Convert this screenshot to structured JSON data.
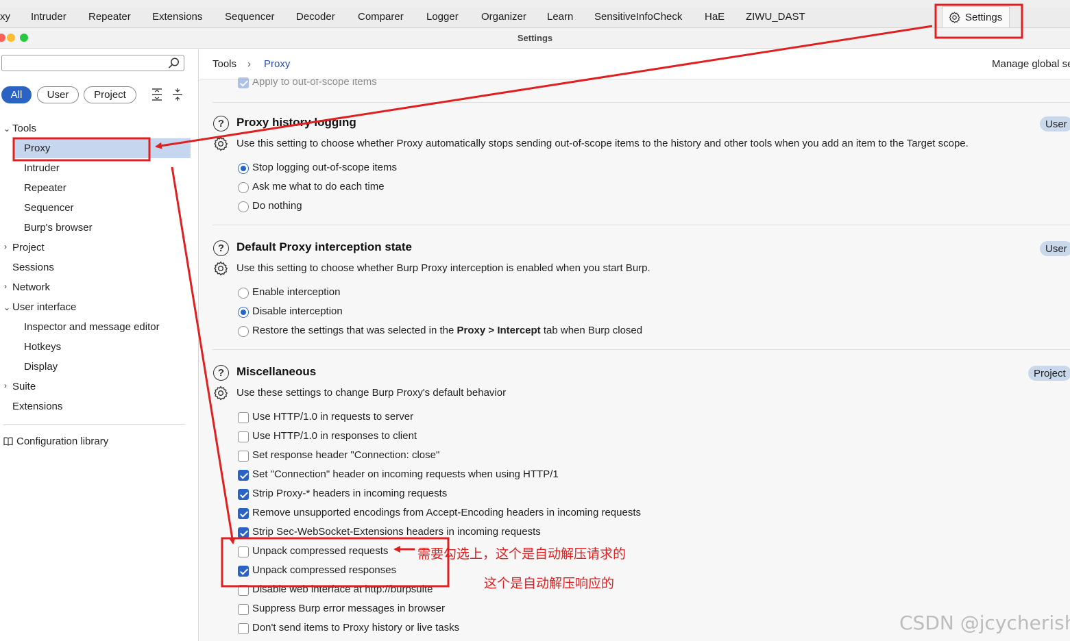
{
  "top_tabs": [
    "xy",
    "Intruder",
    "Repeater",
    "Extensions",
    "Sequencer",
    "Decoder",
    "Comparer",
    "Logger",
    "Organizer",
    "Learn",
    "SensitiveInfoCheck",
    "HaE",
    "ZIWU_DAST"
  ],
  "settings_tab": {
    "label": "Settings",
    "icon": "gear-icon"
  },
  "window": {
    "title": "Settings"
  },
  "sidebar": {
    "search": {
      "value": "",
      "placeholder": "",
      "icon": "search-icon"
    },
    "filters": [
      "All",
      "User",
      "Project"
    ],
    "selected_filter": "All",
    "tree": [
      {
        "label": "Tools",
        "expanded": true,
        "children": [
          "Proxy",
          "Intruder",
          "Repeater",
          "Sequencer",
          "Burp's browser"
        ]
      },
      {
        "label": "Project",
        "expandable": true
      },
      {
        "label": "Sessions"
      },
      {
        "label": "Network",
        "expandable": true
      },
      {
        "label": "User interface",
        "expanded": true,
        "children": [
          "Inspector and message editor",
          "Hotkeys",
          "Display"
        ]
      },
      {
        "label": "Suite",
        "expandable": true
      },
      {
        "label": "Extensions"
      }
    ],
    "selected_item": "Proxy",
    "config_library": "Configuration library"
  },
  "breadcrumb": {
    "root": "Tools",
    "separator": "›",
    "current": "Proxy",
    "right_text": "Manage global se"
  },
  "partial_row": "Apply to out-of-scope items",
  "sections": [
    {
      "title": "Proxy history logging",
      "badge": "User",
      "description": "Use this setting to choose whether Proxy automatically stops sending out-of-scope items to the history and other tools when you add an item to the Target scope.",
      "options": [
        {
          "label": "Stop logging out-of-scope items",
          "selected": true
        },
        {
          "label": "Ask me what to do each time",
          "selected": false
        },
        {
          "label": "Do nothing",
          "selected": false
        }
      ]
    },
    {
      "title": "Default Proxy interception state",
      "badge": "User",
      "description": "Use this setting to choose whether Burp Proxy interception is enabled when you start Burp.",
      "options": [
        {
          "label": "Enable interception",
          "selected": false
        },
        {
          "label": "Disable interception",
          "selected": true
        },
        {
          "label_parts": [
            "Restore the settings that was selected in the ",
            "Proxy",
            " > ",
            "Intercept",
            " tab when Burp closed"
          ],
          "selected": false
        }
      ]
    },
    {
      "title": "Miscellaneous",
      "badge": "Project",
      "description": "Use these settings to change Burp Proxy's default behavior",
      "checkboxes": [
        {
          "label": "Use HTTP/1.0 in requests to server",
          "checked": false
        },
        {
          "label": "Use HTTP/1.0 in responses to client",
          "checked": false
        },
        {
          "label": "Set response header \"Connection: close\"",
          "checked": false
        },
        {
          "label": "Set \"Connection\" header on incoming requests when using HTTP/1",
          "checked": true
        },
        {
          "label": "Strip Proxy-* headers in incoming requests",
          "checked": true
        },
        {
          "label": "Remove unsupported encodings from Accept-Encoding headers in incoming requests",
          "checked": true
        },
        {
          "label": "Strip Sec-WebSocket-Extensions headers in incoming requests",
          "checked": true
        },
        {
          "label": "Unpack compressed requests",
          "checked": false
        },
        {
          "label": "Unpack compressed responses",
          "checked": true
        },
        {
          "label": "Disable web interface at http://burpsuite",
          "checked": false
        },
        {
          "label": "Suppress Burp error messages in browser",
          "checked": false
        },
        {
          "label": "Don't send items to Proxy history or live tasks",
          "checked": false
        }
      ]
    }
  ],
  "annotations": {
    "note_requests": "需要勾选上，这个是自动解压请求的",
    "note_responses": "这个是自动解压响应的",
    "color": "#e02020"
  },
  "watermark": "CSDN @jcycherish",
  "colors": {
    "accent": "#2a63c4",
    "selection": "#c6d6ee",
    "badge": "#c9d8ea",
    "annotation": "#e02020"
  }
}
